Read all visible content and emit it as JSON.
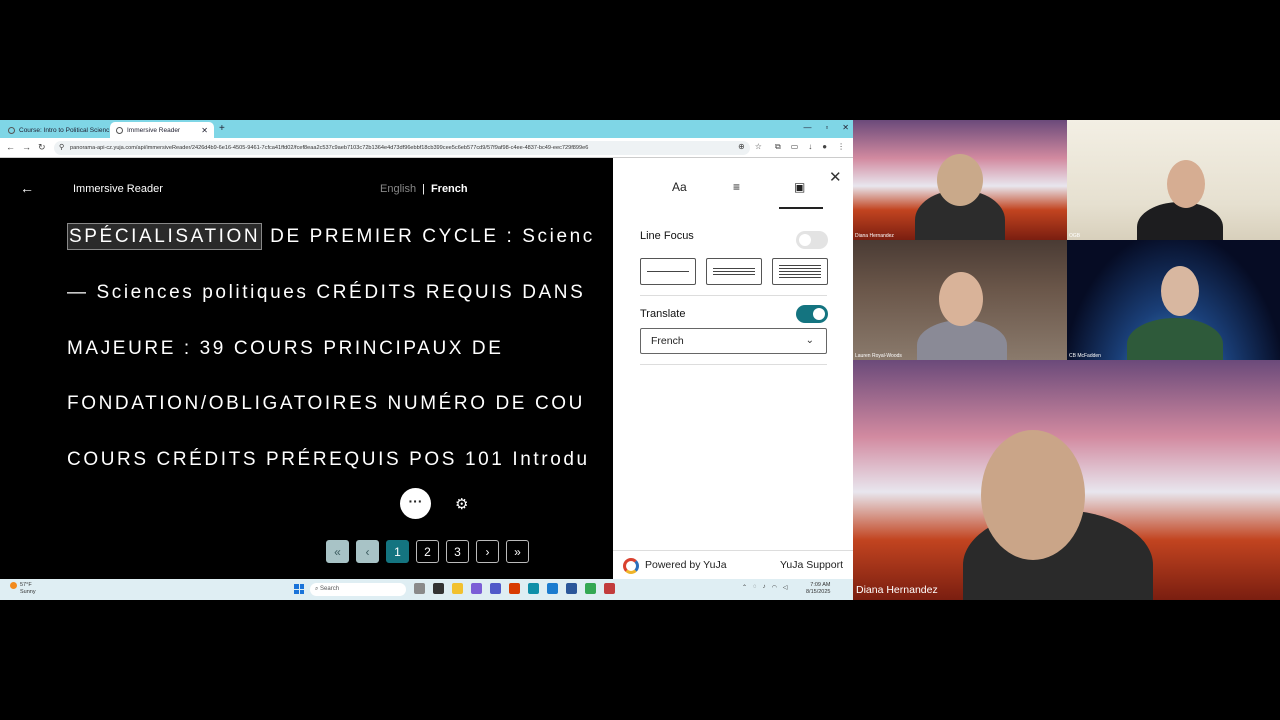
{
  "browser": {
    "tabs": [
      {
        "label": "Course: Intro to Political Scienc"
      },
      {
        "label": "Immersive Reader"
      }
    ],
    "url": "panorama-api-cz.yuja.com/api/immersiveReader/2426d4b9-6e16-4505-9461-7cfca41ffd02/fcef8eaa2c537c9aeb7103c72b1364e4d73df96ebbf18cb399cee5c6eb577cd9/57f9af98-c4ee-4837-bc49-eec729f899e6"
  },
  "reader": {
    "title": "Immersive Reader",
    "languages": {
      "source": "English",
      "separator": "|",
      "current": "French"
    },
    "highlight_word": "SPÉCIALISATION",
    "lines": [
      " DE PREMIER CYCLE : Scienc",
      "— Sciences politiques CRÉDITS REQUIS DANS",
      "MAJEURE : 39 COURS PRINCIPAUX DE",
      "FONDATION/OBLIGATOIRES NUMÉRO DE COU",
      "COURS CRÉDITS PRÉREQUIS POS 101 Introdu"
    ],
    "more_label": "···",
    "pagination": {
      "first": "«",
      "prev": "‹",
      "pages": [
        "1",
        "2",
        "3"
      ],
      "next": "›",
      "last": "»",
      "current": 1
    }
  },
  "panel": {
    "tabs": [
      {
        "icon": "text-size-icon",
        "label": "Aa"
      },
      {
        "icon": "grammar-lines-icon",
        "label": ""
      },
      {
        "icon": "reading-preferences-icon",
        "label": ""
      }
    ],
    "line_focus": {
      "label": "Line Focus",
      "enabled": false,
      "options": [
        "1",
        "3",
        "5"
      ]
    },
    "translate": {
      "label": "Translate",
      "enabled": true,
      "selected": "French"
    },
    "footer": {
      "powered": "Powered by YuJa",
      "support": "YuJa Support"
    }
  },
  "taskbar": {
    "weather_temp": "57°F",
    "weather_desc": "Sunny",
    "search_placeholder": "Search",
    "time": "7:09 AM",
    "date": "8/15/2025"
  },
  "participants": [
    {
      "name": "Diana Hernandez"
    },
    {
      "name": "OGB"
    },
    {
      "name": "Lauren Royal-Woods"
    },
    {
      "name": "CB McFadden"
    },
    {
      "name": "Diana Hernandez"
    }
  ],
  "colors": {
    "accent": "#147480",
    "tabbar": "#7fd6e6",
    "reader_bg": "#000000",
    "panel_bg": "#ffffff"
  }
}
